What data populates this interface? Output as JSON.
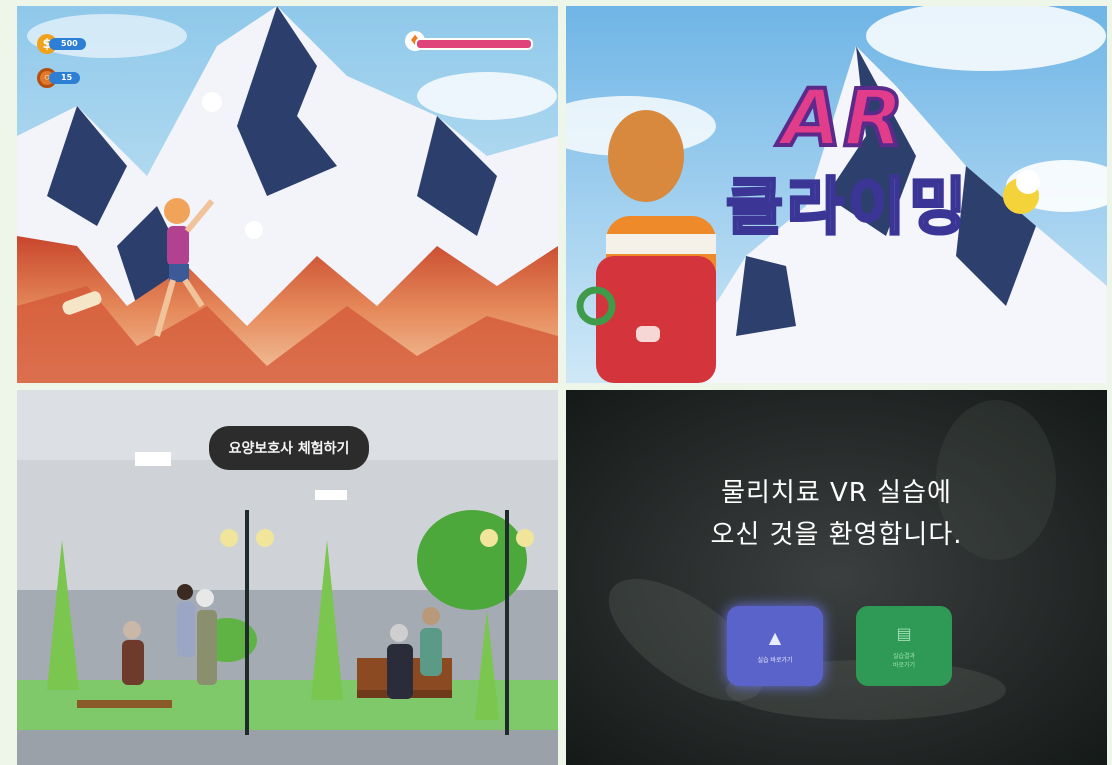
{
  "climbing_game": {
    "coins": "500",
    "donuts": "15",
    "coin_icon": "dollar-coin-icon",
    "donut_icon": "donut-icon",
    "fire_icon": "flame-icon",
    "health_color": "#e0437a"
  },
  "title_screen": {
    "logo_line1": "AR",
    "logo_line2": "클라이밍",
    "logo_color": "#e23d8a"
  },
  "caregiver_sim": {
    "caption": "요양보호사 체험하기"
  },
  "vr_menu": {
    "welcome_line1": "물리치료 VR 실습에",
    "welcome_line2": "오신 것을 환영합니다.",
    "practice_button": "실습 바로가기",
    "result_button_line1": "실습결과",
    "result_button_line2": "바로가기"
  }
}
